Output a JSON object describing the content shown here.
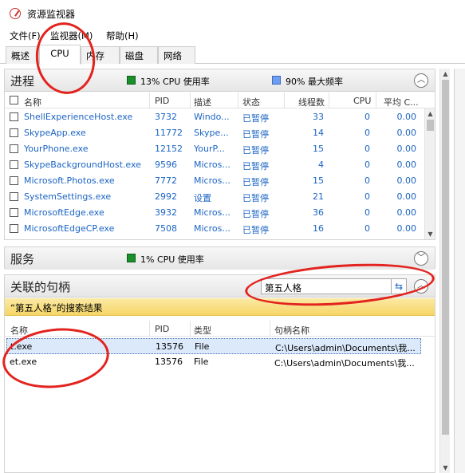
{
  "window": {
    "title": "资源监视器"
  },
  "menu": [
    "文件(F)",
    "监视器(M)",
    "帮助(H)"
  ],
  "tabs": [
    "概述",
    "CPU",
    "内存",
    "磁盘",
    "网络"
  ],
  "active_tab": "CPU",
  "processes": {
    "title": "进程",
    "cpu_usage": "13% CPU 使用率",
    "max_freq": "90% 最大频率",
    "columns": [
      "名称",
      "PID",
      "描述",
      "状态",
      "线程数",
      "CPU",
      "平均 C..."
    ],
    "rows": [
      {
        "name": "ShellExperienceHost.exe",
        "pid": "3732",
        "desc": "Windo...",
        "status": "已暂停",
        "threads": "33",
        "cpu": "0",
        "avg": "0.00"
      },
      {
        "name": "SkypeApp.exe",
        "pid": "11772",
        "desc": "Skype...",
        "status": "已暂停",
        "threads": "14",
        "cpu": "0",
        "avg": "0.00"
      },
      {
        "name": "YourPhone.exe",
        "pid": "12152",
        "desc": "YourP...",
        "status": "已暂停",
        "threads": "15",
        "cpu": "0",
        "avg": "0.00"
      },
      {
        "name": "SkypeBackgroundHost.exe",
        "pid": "9596",
        "desc": "Micros...",
        "status": "已暂停",
        "threads": "4",
        "cpu": "0",
        "avg": "0.00"
      },
      {
        "name": "Microsoft.Photos.exe",
        "pid": "7772",
        "desc": "Micros...",
        "status": "已暂停",
        "threads": "15",
        "cpu": "0",
        "avg": "0.00"
      },
      {
        "name": "SystemSettings.exe",
        "pid": "2992",
        "desc": "设置",
        "status": "已暂停",
        "threads": "21",
        "cpu": "0",
        "avg": "0.00"
      },
      {
        "name": "MicrosoftEdge.exe",
        "pid": "3932",
        "desc": "Micros...",
        "status": "已暂停",
        "threads": "36",
        "cpu": "0",
        "avg": "0.00"
      },
      {
        "name": "MicrosoftEdgeCP.exe",
        "pid": "7508",
        "desc": "Micros...",
        "status": "已暂停",
        "threads": "16",
        "cpu": "0",
        "avg": "0.00"
      }
    ]
  },
  "services": {
    "title": "服务",
    "cpu_usage": "1% CPU 使用率"
  },
  "handles": {
    "title": "关联的句柄",
    "search_value": "第五人格",
    "result_text": "“第五人格”的搜索结果",
    "columns": [
      "名称",
      "PID",
      "类型",
      "句柄名称"
    ],
    "rows": [
      {
        "name": "t.exe",
        "pid": "13576",
        "type": "File",
        "handle": "C:\\Users\\admin\\Documents\\我..."
      },
      {
        "name": "et.exe",
        "pid": "13576",
        "type": "File",
        "handle": "C:\\Users\\admin\\Documents\\我..."
      }
    ]
  },
  "colors": {
    "accent_blue": "#1b64c4",
    "annotation_red": "#e3231e",
    "result_yellow": "#f6d667"
  }
}
